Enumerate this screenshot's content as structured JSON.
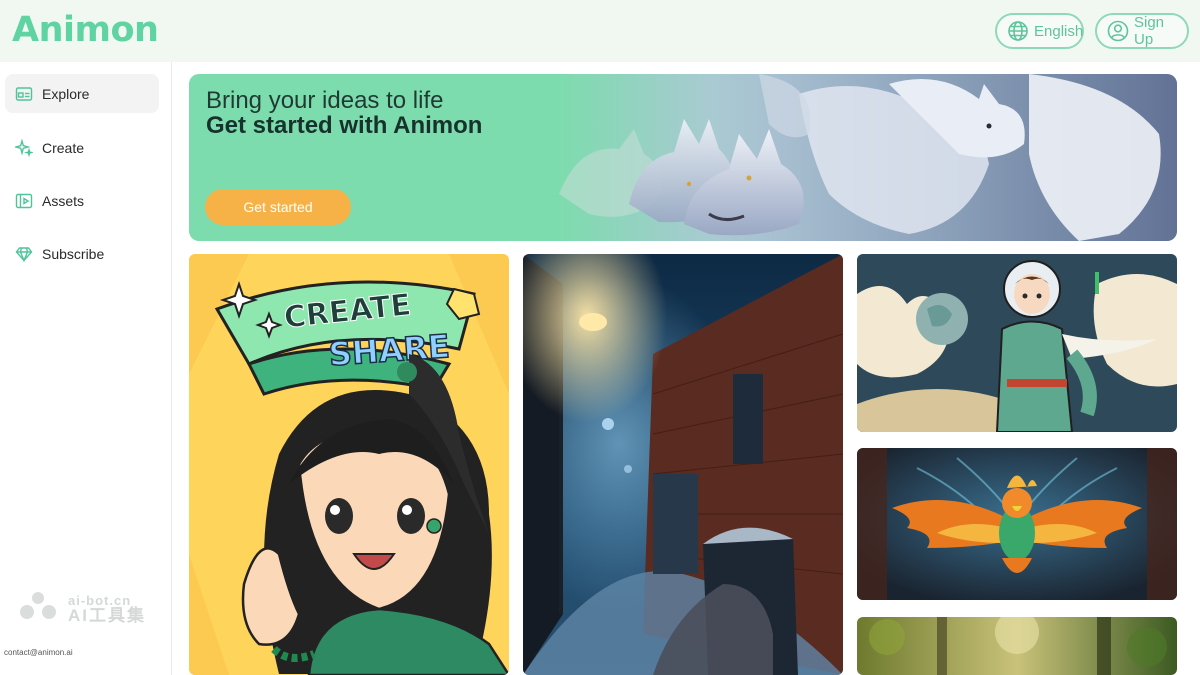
{
  "header": {
    "logo": "Animon",
    "language_label": "English",
    "signup_label": "Sign Up"
  },
  "sidebar": {
    "items": [
      {
        "label": "Explore",
        "icon": "explore-icon",
        "active": true
      },
      {
        "label": "Create",
        "icon": "sparkle-icon",
        "active": false
      },
      {
        "label": "Assets",
        "icon": "assets-icon",
        "active": false
      },
      {
        "label": "Subscribe",
        "icon": "diamond-icon",
        "active": false
      }
    ],
    "watermark_top": "ai-bot.cn",
    "watermark_bottom": "AI工具集",
    "contact": "contact@animon.ai"
  },
  "banner": {
    "title_line1": "Bring your ideas to life",
    "title_line2": "Get started with Animon",
    "cta_label": "Get started"
  },
  "gallery": {
    "cards": [
      {
        "name": "create-share-anime-girl",
        "text_line1": "CREATE",
        "text_line2": "SHARE"
      },
      {
        "name": "snowy-alley-night"
      },
      {
        "name": "anime-astronaut"
      },
      {
        "name": "fiery-phoenix-bird"
      },
      {
        "name": "forest-scene"
      }
    ]
  },
  "colors": {
    "brand": "#5fd3a2",
    "header_bg": "#f1f8f2",
    "banner_green": "#7ddcad",
    "cta_orange": "#f7b247"
  }
}
